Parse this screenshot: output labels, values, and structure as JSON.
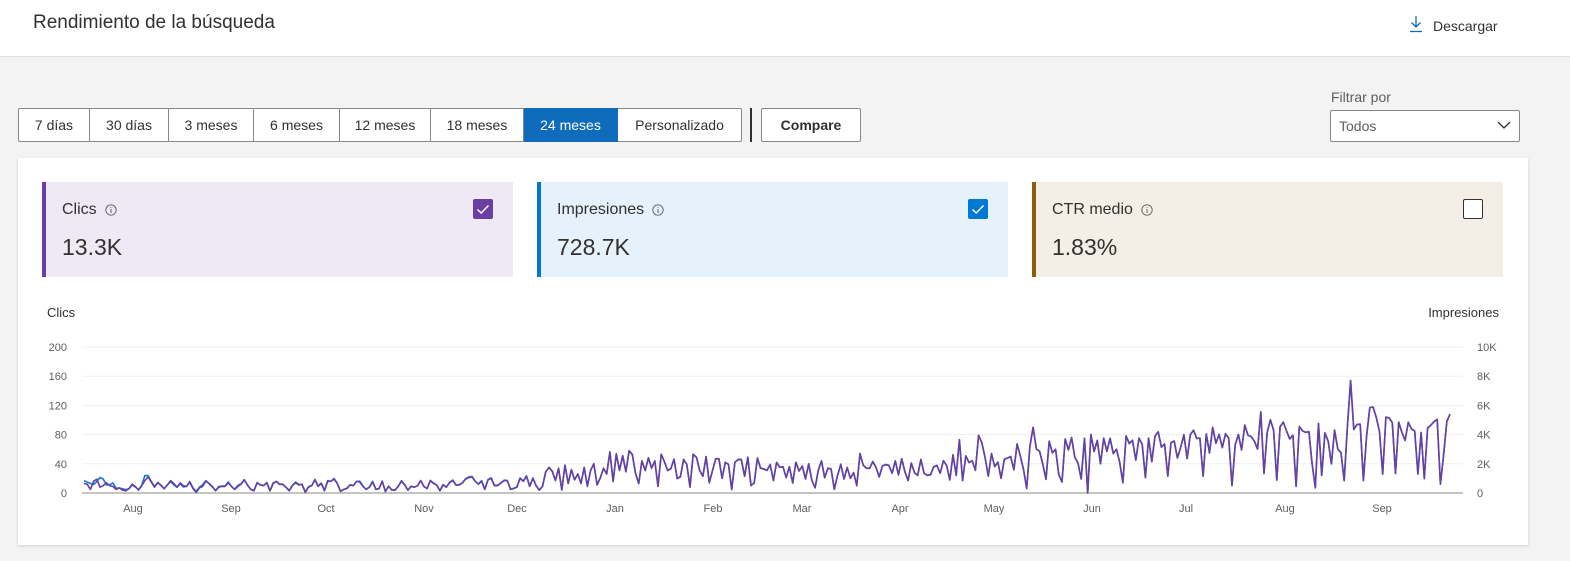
{
  "header": {
    "title": "Rendimiento de la búsqueda",
    "download_label": "Descargar"
  },
  "ranges": {
    "items": [
      "7 días",
      "30 días",
      "3 meses",
      "6 meses",
      "12 meses",
      "18 meses",
      "24 meses",
      "Personalizado"
    ],
    "active_index": 6
  },
  "compare_label": "Compare",
  "filter": {
    "label": "Filtrar por",
    "value": "Todos"
  },
  "cards": [
    {
      "label": "Clics",
      "value": "13.3K",
      "checked": true,
      "accent": "#6b3fa0",
      "bg": "#efe9f5",
      "check_color": "#6b3fa0"
    },
    {
      "label": "Impresiones",
      "value": "728.7K",
      "checked": true,
      "accent": "#0078d4",
      "bg": "#e5f1fb",
      "check_color": "#0078d4"
    },
    {
      "label": "CTR medio",
      "value": "1.83%",
      "checked": false,
      "accent": "#8a5b13",
      "bg": "#f3efe6",
      "check_color": "#8a5b13"
    }
  ],
  "chart_data": {
    "type": "line",
    "y_left_label": "Clics",
    "y_right_label": "Impresiones",
    "y_left_ticks": [
      "0",
      "40",
      "80",
      "120",
      "160",
      "200"
    ],
    "y_right_ticks": [
      "0",
      "2K",
      "4K",
      "6K",
      "8K",
      "10K"
    ],
    "ylim_left": [
      0,
      200
    ],
    "ylim_right": [
      0,
      10000
    ],
    "month_labels": [
      "Aug",
      "Sep",
      "Oct",
      "Nov",
      "Dec",
      "Jan",
      "Feb",
      "Mar",
      "Apr",
      "May",
      "Jun",
      "Jul",
      "Aug",
      "Sep"
    ],
    "grid": true,
    "series": [
      {
        "name": "Clics",
        "axis": "left",
        "color": "#6b3fa0",
        "values": [
          13,
          12,
          5,
          16,
          19,
          8,
          10,
          14,
          10,
          9,
          5,
          7,
          4,
          3,
          6,
          12,
          9,
          4,
          10,
          17,
          22,
          15,
          8,
          14,
          11,
          6,
          11,
          17,
          13,
          8,
          14,
          10,
          9,
          15,
          6,
          1,
          7,
          9,
          16,
          13,
          9,
          3,
          8,
          9,
          9,
          14,
          9,
          5,
          9,
          12,
          18,
          11,
          5,
          3,
          14,
          11,
          10,
          14,
          3,
          13,
          16,
          12,
          12,
          8,
          3,
          10,
          14,
          11,
          12,
          1,
          8,
          10,
          18,
          9,
          13,
          3,
          16,
          16,
          19,
          13,
          2,
          5,
          6,
          11,
          10,
          16,
          15,
          9,
          5,
          8,
          15,
          5,
          6,
          16,
          2,
          9,
          4,
          4,
          9,
          16,
          11,
          4,
          9,
          8,
          10,
          17,
          9,
          6,
          17,
          13,
          11,
          3,
          11,
          8,
          14,
          17,
          11,
          11,
          14,
          19,
          21,
          22,
          16,
          12,
          16,
          5,
          18,
          20,
          10,
          10,
          14,
          17,
          17,
          5,
          6,
          8,
          20,
          16,
          23,
          9,
          20,
          10,
          4,
          9,
          29,
          35,
          30,
          17,
          34,
          4,
          38,
          13,
          32,
          18,
          26,
          13,
          35,
          9,
          31,
          40,
          11,
          21,
          34,
          26,
          56,
          16,
          53,
          31,
          51,
          29,
          58,
          53,
          27,
          13,
          44,
          31,
          48,
          34,
          44,
          9,
          53,
          43,
          31,
          33,
          46,
          20,
          22,
          46,
          39,
          8,
          53,
          49,
          31,
          23,
          50,
          14,
          31,
          47,
          47,
          20,
          42,
          39,
          5,
          42,
          46,
          46,
          23,
          49,
          10,
          14,
          48,
          34,
          33,
          31,
          39,
          17,
          42,
          35,
          36,
          21,
          36,
          14,
          42,
          30,
          37,
          19,
          40,
          17,
          7,
          31,
          44,
          21,
          34,
          33,
          5,
          24,
          39,
          19,
          35,
          20,
          28,
          10,
          54,
          38,
          34,
          34,
          43,
          35,
          22,
          37,
          39,
          38,
          27,
          44,
          25,
          47,
          29,
          17,
          41,
          28,
          24,
          46,
          27,
          24,
          25,
          36,
          38,
          27,
          44,
          38,
          18,
          52,
          24,
          73,
          17,
          51,
          42,
          44,
          31,
          79,
          69,
          49,
          23,
          54,
          36,
          42,
          20,
          46,
          48,
          50,
          32,
          67,
          51,
          32,
          6,
          64,
          90,
          60,
          57,
          39,
          19,
          71,
          55,
          60,
          25,
          15,
          74,
          59,
          76,
          49,
          41,
          19,
          75,
          0,
          80,
          57,
          72,
          40,
          75,
          57,
          75,
          54,
          60,
          42,
          14,
          78,
          68,
          72,
          45,
          75,
          67,
          21,
          75,
          43,
          78,
          84,
          63,
          67,
          23,
          69,
          71,
          48,
          62,
          80,
          47,
          80,
          86,
          75,
          75,
          23,
          81,
          55,
          90,
          68,
          80,
          62,
          81,
          75,
          10,
          66,
          80,
          59,
          93,
          79,
          77,
          71,
          60,
          111,
          27,
          83,
          100,
          86,
          18,
          91,
          97,
          85,
          74,
          79,
          9,
          91,
          85,
          83,
          84,
          40,
          7,
          95,
          24,
          82,
          71,
          40,
          86,
          60,
          55,
          17,
          91,
          154,
          87,
          94,
          94,
          17,
          78,
          117,
          118,
          104,
          84,
          26,
          104,
          103,
          96,
          27,
          97,
          83,
          72,
          97,
          88,
          85,
          26,
          83,
          20,
          89,
          93,
          98,
          101,
          12,
          52,
          98,
          108
        ]
      },
      {
        "name": "Impresiones",
        "axis": "right",
        "color": "#0f7ad8",
        "values": [
          850,
          750,
          650,
          580,
          790,
          1060,
          960,
          550,
          570,
          690,
          320,
          340,
          290,
          230,
          280,
          540,
          410,
          230,
          530,
          1200,
          1190,
          780,
          450,
          720,
          510,
          290,
          560,
          780,
          560,
          390,
          630,
          410,
          450,
          780,
          350,
          110,
          390,
          560,
          850,
          640,
          410,
          170,
          440,
          470,
          480,
          760,
          440,
          260,
          520,
          630,
          910,
          540,
          260,
          170,
          710,
          560,
          500,
          720,
          150,
          690,
          780,
          580,
          590,
          390,
          170,
          530,
          750,
          580,
          580,
          60,
          430,
          500,
          940,
          480,
          680,
          170,
          850,
          800,
          990,
          660,
          120,
          250,
          330,
          560,
          520,
          790,
          810,
          480,
          240,
          410,
          800,
          280,
          290,
          820,
          100,
          470,
          210,
          200,
          460,
          840,
          560,
          200,
          470,
          400,
          490,
          850,
          440,
          310,
          860,
          680,
          540,
          170,
          580,
          400,
          720,
          890,
          540,
          560,
          690,
          970,
          1100,
          1140,
          800,
          610,
          840,
          270,
          920,
          1040,
          530,
          530,
          680,
          880,
          850,
          260,
          320,
          420,
          1030,
          810,
          1180,
          470,
          1030,
          510,
          200,
          460,
          1430,
          1750,
          1490,
          860,
          1670,
          220,
          1920,
          650,
          1580,
          910,
          1300,
          680,
          1740,
          480,
          1540,
          2000,
          570,
          1030,
          1680,
          1320,
          2820,
          780,
          2690,
          1550,
          2570,
          1470,
          2880,
          2630,
          1360,
          640,
          2190,
          1530,
          2420,
          1720,
          2190,
          470,
          2660,
          2150,
          1540,
          1670,
          2320,
          980,
          1120,
          2300,
          1950,
          420,
          2660,
          2430,
          1530,
          1150,
          2480,
          700,
          1530,
          2330,
          2350,
          1010,
          2090,
          1970,
          240,
          2110,
          2280,
          2290,
          1140,
          2440,
          520,
          690,
          2390,
          1700,
          1640,
          1550,
          1940,
          860,
          2090,
          1770,
          1780,
          1070,
          1810,
          680,
          2100,
          1520,
          1840,
          970,
          2000,
          870,
          360,
          1570,
          2200,
          1040,
          1700,
          1640,
          260,
          1180,
          1970,
          970,
          1730,
          1020,
          1390,
          510,
          2700,
          1920,
          1700,
          1680,
          2160,
          1760,
          1100,
          1850,
          1930,
          1900,
          1370,
          2200,
          1240,
          2350,
          1470,
          850,
          2050,
          1400,
          1220,
          2300,
          1340,
          1220,
          1250,
          1780,
          1880,
          1360,
          2220,
          1880,
          900,
          2620,
          1220,
          3650,
          860,
          2540,
          2080,
          2210,
          1560,
          3960,
          3430,
          2460,
          1160,
          2700,
          1820,
          2120,
          1010,
          2310,
          2400,
          2480,
          1590,
          3360,
          2550,
          1620,
          320,
          3180,
          4490,
          3010,
          2860,
          1970,
          930,
          3530,
          2770,
          2980,
          1260,
          760,
          3700,
          2960,
          3780,
          2440,
          2070,
          970,
          3750,
          10,
          4000,
          2840,
          3590,
          2000,
          3760,
          2860,
          3740,
          2700,
          3000,
          2090,
          720,
          3910,
          3380,
          3620,
          2250,
          3760,
          3330,
          1060,
          3760,
          2150,
          3900,
          4180,
          3140,
          3360,
          1150,
          3440,
          3570,
          2400,
          3100,
          3980,
          2370,
          3980,
          4300,
          3740,
          3760,
          1150,
          4030,
          2740,
          4490,
          3420,
          4020,
          3120,
          4060,
          3760,
          510,
          3290,
          4010,
          2950,
          4640,
          3960,
          3860,
          3540,
          3020,
          5560,
          1330,
          4160,
          5020,
          4310,
          880,
          4530,
          4860,
          4270,
          3710,
          3960,
          470,
          4550,
          4260,
          4160,
          4200,
          2000,
          360,
          4770,
          1200,
          4120,
          3550,
          1990,
          4310,
          3010,
          2770,
          840,
          4550,
          7700,
          4340,
          4700,
          4720,
          860,
          3910,
          5850,
          5890,
          5200,
          4180,
          1280,
          5180,
          5140,
          4820,
          1330,
          4860,
          4150,
          3610,
          4840,
          4380,
          4230,
          1290,
          4130,
          980,
          4430,
          4640,
          4880,
          5030,
          620,
          2600,
          4880,
          5410
        ]
      }
    ]
  }
}
